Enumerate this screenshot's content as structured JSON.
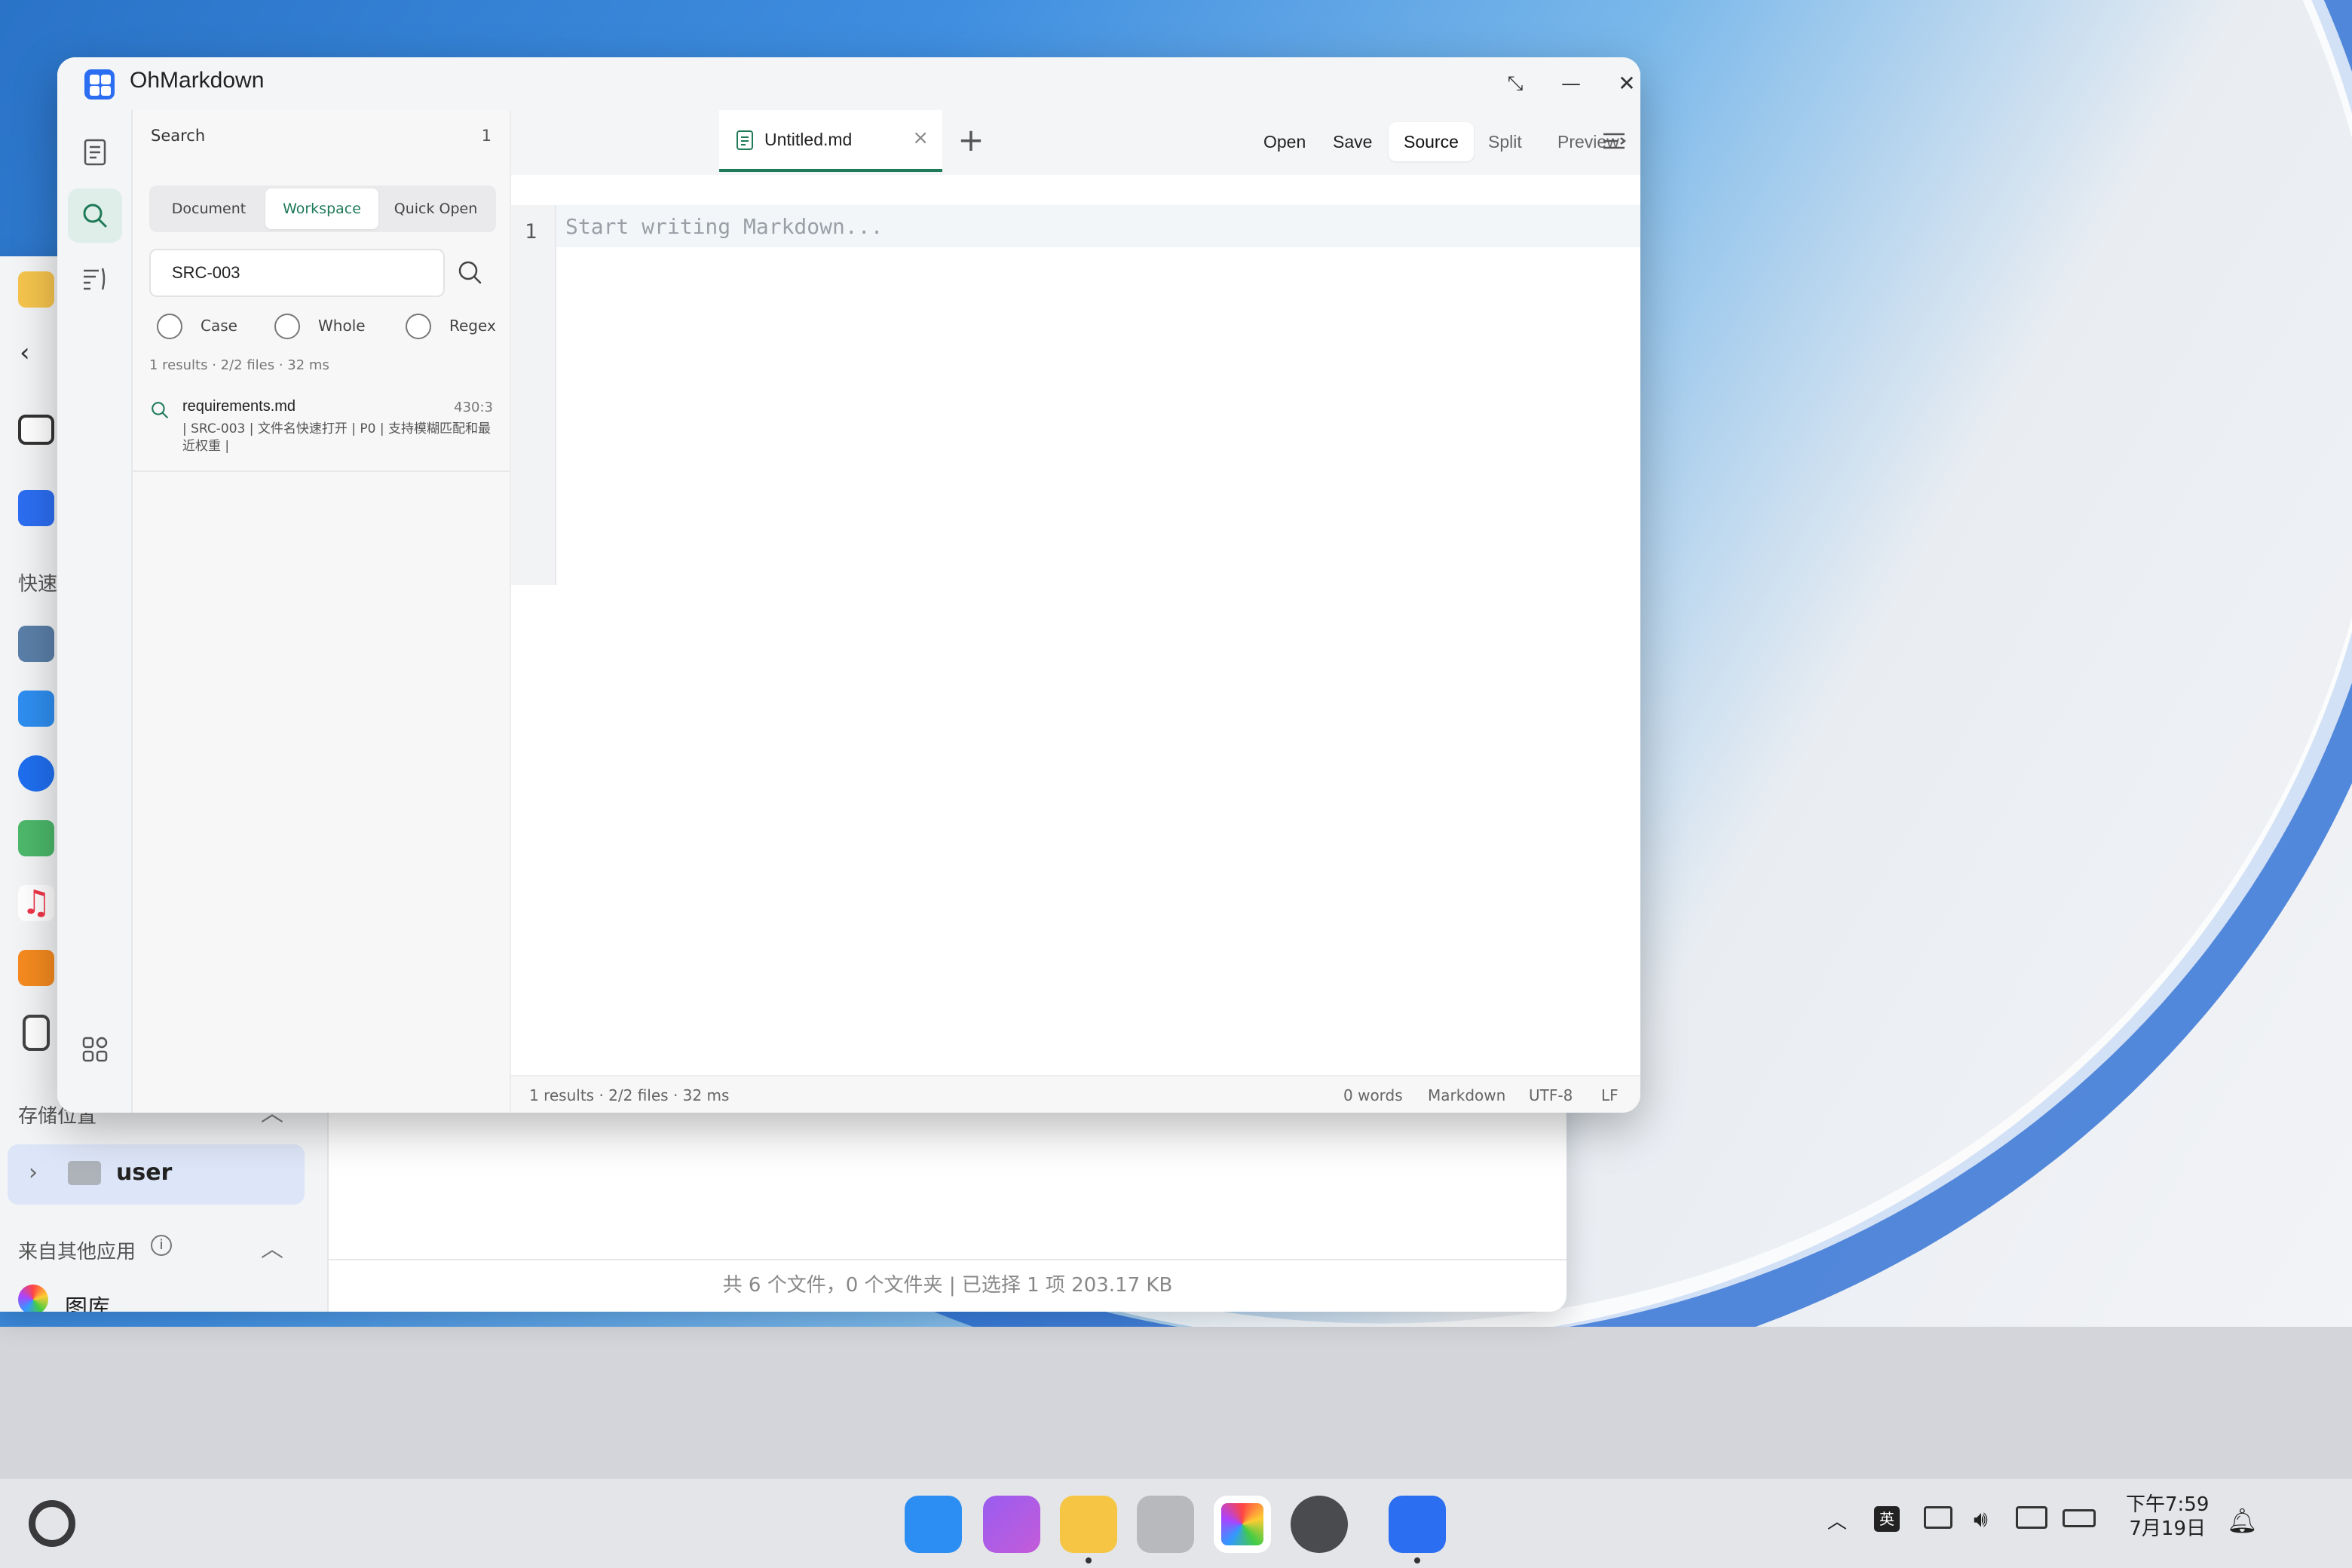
{
  "app": {
    "title": "OhMarkdown"
  },
  "window_controls": {
    "restore": "⤡",
    "minimize": "—",
    "close": "✕"
  },
  "search_panel": {
    "heading": "Search",
    "count": "1",
    "modes": [
      {
        "label": "Document",
        "active": false
      },
      {
        "label": "Workspace",
        "active": true
      },
      {
        "label": "Quick Open",
        "active": false
      }
    ],
    "query": "SRC-003",
    "options": [
      {
        "label": "Case",
        "checked": false
      },
      {
        "label": "Whole",
        "checked": false
      },
      {
        "label": "Regex",
        "checked": false
      }
    ],
    "meta": "1 results · 2/2 files · 32 ms",
    "results": [
      {
        "file": "requirements.md",
        "position": "430:3",
        "snippet": "| SRC-003 | 文件名快速打开 | P0 | 支持模糊匹配和最近权重 |"
      }
    ]
  },
  "tabs": [
    {
      "label": "Untitled.md",
      "close": "×"
    }
  ],
  "tab_add": "+",
  "toolbar": {
    "open": "Open",
    "save": "Save",
    "source": "Source",
    "split": "Split",
    "preview": "Preview"
  },
  "editor": {
    "line_number": "1",
    "placeholder": "Start writing Markdown..."
  },
  "status": {
    "left": "1 results · 2/2 files · 32 ms",
    "words": "0 words",
    "language": "Markdown",
    "encoding": "UTF-8",
    "eol": "LF"
  },
  "file_manager": {
    "quick_label": "快速",
    "storage_label": "存储位置",
    "location": "user",
    "other_apps_label": "来自其他应用",
    "gallery_label": "图库",
    "status": "共 6 个文件，0 个文件夹 | 已选择 1 项  203.17 KB"
  },
  "taskbar": {
    "ime": "英",
    "time": "下午7:59",
    "date": "7月19日"
  }
}
